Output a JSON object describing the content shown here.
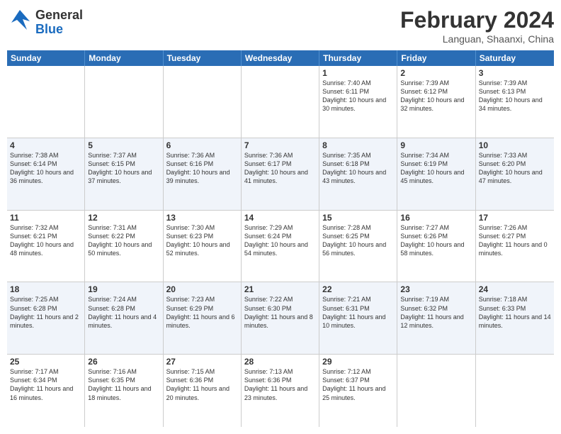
{
  "logo": {
    "general": "General",
    "blue": "Blue"
  },
  "title": "February 2024",
  "subtitle": "Languan, Shaanxi, China",
  "header_days": [
    "Sunday",
    "Monday",
    "Tuesday",
    "Wednesday",
    "Thursday",
    "Friday",
    "Saturday"
  ],
  "rows": [
    {
      "alt": false,
      "cells": [
        {
          "num": "",
          "text": ""
        },
        {
          "num": "",
          "text": ""
        },
        {
          "num": "",
          "text": ""
        },
        {
          "num": "",
          "text": ""
        },
        {
          "num": "1",
          "text": "Sunrise: 7:40 AM\nSunset: 6:11 PM\nDaylight: 10 hours and 30 minutes."
        },
        {
          "num": "2",
          "text": "Sunrise: 7:39 AM\nSunset: 6:12 PM\nDaylight: 10 hours and 32 minutes."
        },
        {
          "num": "3",
          "text": "Sunrise: 7:39 AM\nSunset: 6:13 PM\nDaylight: 10 hours and 34 minutes."
        }
      ]
    },
    {
      "alt": true,
      "cells": [
        {
          "num": "4",
          "text": "Sunrise: 7:38 AM\nSunset: 6:14 PM\nDaylight: 10 hours and 36 minutes."
        },
        {
          "num": "5",
          "text": "Sunrise: 7:37 AM\nSunset: 6:15 PM\nDaylight: 10 hours and 37 minutes."
        },
        {
          "num": "6",
          "text": "Sunrise: 7:36 AM\nSunset: 6:16 PM\nDaylight: 10 hours and 39 minutes."
        },
        {
          "num": "7",
          "text": "Sunrise: 7:36 AM\nSunset: 6:17 PM\nDaylight: 10 hours and 41 minutes."
        },
        {
          "num": "8",
          "text": "Sunrise: 7:35 AM\nSunset: 6:18 PM\nDaylight: 10 hours and 43 minutes."
        },
        {
          "num": "9",
          "text": "Sunrise: 7:34 AM\nSunset: 6:19 PM\nDaylight: 10 hours and 45 minutes."
        },
        {
          "num": "10",
          "text": "Sunrise: 7:33 AM\nSunset: 6:20 PM\nDaylight: 10 hours and 47 minutes."
        }
      ]
    },
    {
      "alt": false,
      "cells": [
        {
          "num": "11",
          "text": "Sunrise: 7:32 AM\nSunset: 6:21 PM\nDaylight: 10 hours and 48 minutes."
        },
        {
          "num": "12",
          "text": "Sunrise: 7:31 AM\nSunset: 6:22 PM\nDaylight: 10 hours and 50 minutes."
        },
        {
          "num": "13",
          "text": "Sunrise: 7:30 AM\nSunset: 6:23 PM\nDaylight: 10 hours and 52 minutes."
        },
        {
          "num": "14",
          "text": "Sunrise: 7:29 AM\nSunset: 6:24 PM\nDaylight: 10 hours and 54 minutes."
        },
        {
          "num": "15",
          "text": "Sunrise: 7:28 AM\nSunset: 6:25 PM\nDaylight: 10 hours and 56 minutes."
        },
        {
          "num": "16",
          "text": "Sunrise: 7:27 AM\nSunset: 6:26 PM\nDaylight: 10 hours and 58 minutes."
        },
        {
          "num": "17",
          "text": "Sunrise: 7:26 AM\nSunset: 6:27 PM\nDaylight: 11 hours and 0 minutes."
        }
      ]
    },
    {
      "alt": true,
      "cells": [
        {
          "num": "18",
          "text": "Sunrise: 7:25 AM\nSunset: 6:28 PM\nDaylight: 11 hours and 2 minutes."
        },
        {
          "num": "19",
          "text": "Sunrise: 7:24 AM\nSunset: 6:28 PM\nDaylight: 11 hours and 4 minutes."
        },
        {
          "num": "20",
          "text": "Sunrise: 7:23 AM\nSunset: 6:29 PM\nDaylight: 11 hours and 6 minutes."
        },
        {
          "num": "21",
          "text": "Sunrise: 7:22 AM\nSunset: 6:30 PM\nDaylight: 11 hours and 8 minutes."
        },
        {
          "num": "22",
          "text": "Sunrise: 7:21 AM\nSunset: 6:31 PM\nDaylight: 11 hours and 10 minutes."
        },
        {
          "num": "23",
          "text": "Sunrise: 7:19 AM\nSunset: 6:32 PM\nDaylight: 11 hours and 12 minutes."
        },
        {
          "num": "24",
          "text": "Sunrise: 7:18 AM\nSunset: 6:33 PM\nDaylight: 11 hours and 14 minutes."
        }
      ]
    },
    {
      "alt": false,
      "cells": [
        {
          "num": "25",
          "text": "Sunrise: 7:17 AM\nSunset: 6:34 PM\nDaylight: 11 hours and 16 minutes."
        },
        {
          "num": "26",
          "text": "Sunrise: 7:16 AM\nSunset: 6:35 PM\nDaylight: 11 hours and 18 minutes."
        },
        {
          "num": "27",
          "text": "Sunrise: 7:15 AM\nSunset: 6:36 PM\nDaylight: 11 hours and 20 minutes."
        },
        {
          "num": "28",
          "text": "Sunrise: 7:13 AM\nSunset: 6:36 PM\nDaylight: 11 hours and 23 minutes."
        },
        {
          "num": "29",
          "text": "Sunrise: 7:12 AM\nSunset: 6:37 PM\nDaylight: 11 hours and 25 minutes."
        },
        {
          "num": "",
          "text": ""
        },
        {
          "num": "",
          "text": ""
        }
      ]
    }
  ]
}
